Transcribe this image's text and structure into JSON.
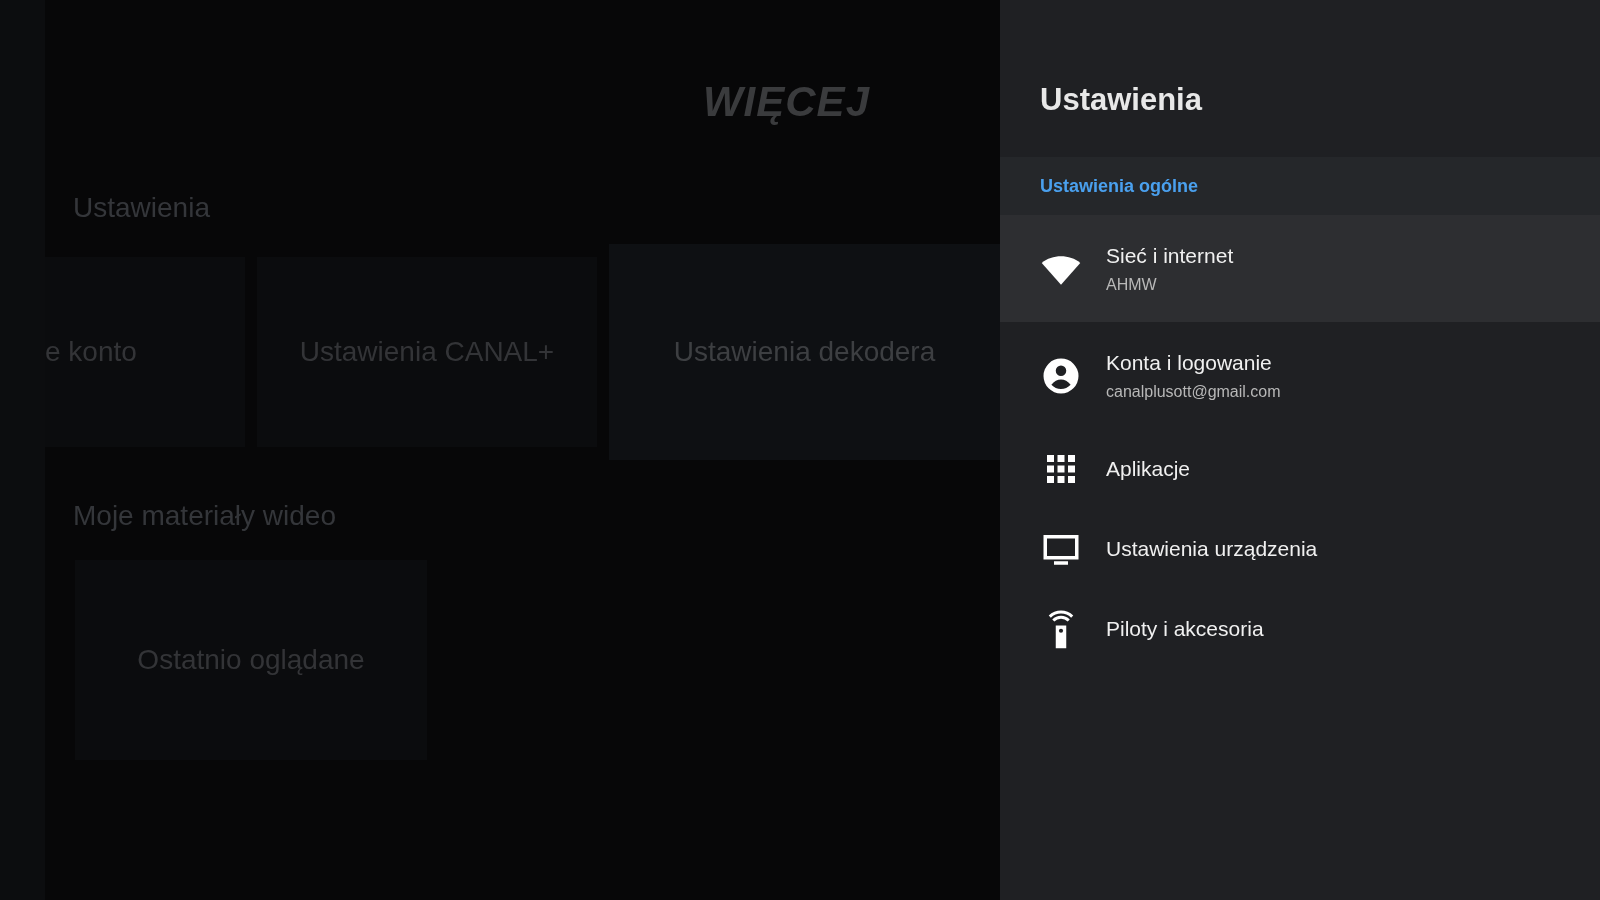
{
  "background": {
    "heading": "WIĘCEJ",
    "sections": [
      {
        "title": "Ustawienia",
        "cards": [
          {
            "label": "e konto",
            "selected": false
          },
          {
            "label": "Ustawienia CANAL+",
            "selected": false
          },
          {
            "label": "Ustawienia dekodera",
            "selected": true
          }
        ]
      },
      {
        "title": "Moje materiały wideo",
        "cards": [
          {
            "label": "Ostatnio oglądane",
            "selected": false
          }
        ]
      }
    ]
  },
  "panel": {
    "title": "Ustawienia",
    "section": "Ustawienia ogólne",
    "items": [
      {
        "label": "Sieć i internet",
        "subtitle": "AHMW",
        "selected": true
      },
      {
        "label": "Konta i logowanie",
        "subtitle": "canalplusott@gmail.com",
        "selected": false
      },
      {
        "label": "Aplikacje",
        "selected": false
      },
      {
        "label": "Ustawienia urządzenia",
        "selected": false
      },
      {
        "label": "Piloty i akcesoria",
        "selected": false
      }
    ]
  }
}
